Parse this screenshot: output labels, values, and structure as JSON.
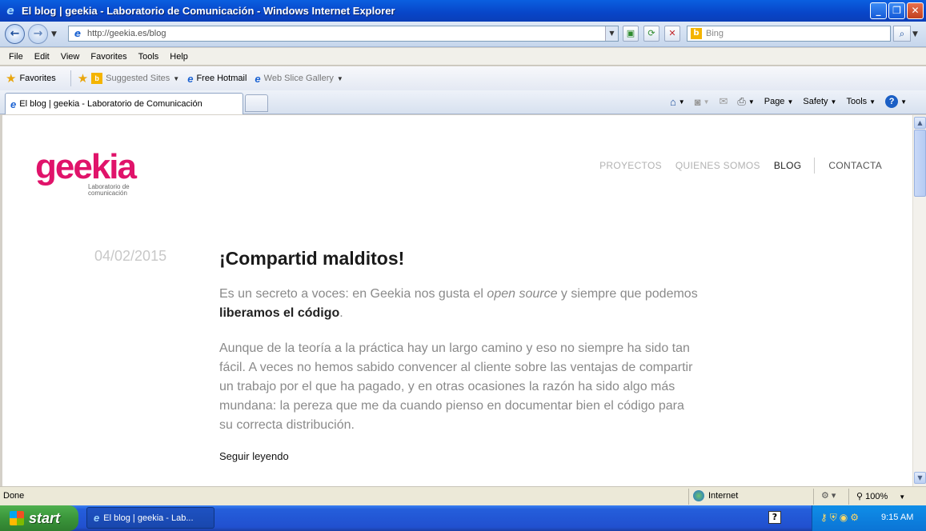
{
  "window": {
    "title": "El blog | geekia - Laboratorio de Comunicación - Windows Internet Explorer",
    "minimize": "_",
    "maximize": "❐",
    "close": "✕"
  },
  "address": {
    "url": "http://geekia.es/blog",
    "search_placeholder": "Bing"
  },
  "menu": [
    "File",
    "Edit",
    "View",
    "Favorites",
    "Tools",
    "Help"
  ],
  "favorites": {
    "label": "Favorites",
    "items": [
      "Suggested Sites",
      "Free Hotmail",
      "Web Slice Gallery"
    ]
  },
  "tab": {
    "title": "El blog | geekia - Laboratorio de Comunicación"
  },
  "commands": {
    "page": "Page",
    "safety": "Safety",
    "tools": "Tools"
  },
  "site": {
    "logo_text": "geekia",
    "logo_sub_1": "Laboratorio de",
    "logo_sub_2": "comunicación",
    "nav": [
      "PROYECTOS",
      "QUIENES SOMOS",
      "BLOG",
      "CONTACTA"
    ],
    "active_nav": "BLOG"
  },
  "post": {
    "date": "04/02/2015",
    "title": "¡Compartid malditos!",
    "p1_a": "Es un secreto a voces: en Geekia nos gusta el ",
    "p1_em": "open source",
    "p1_b": " y siempre que podemos ",
    "p1_strong": "liberamos el código",
    "p1_c": ".",
    "p2": "Aunque de la teoría a la práctica hay un largo camino y eso no siempre ha sido tan fácil. A veces no hemos sabido convencer al cliente sobre las ventajas de compartir un trabajo por el que ha pagado,  y en otras ocasiones la razón ha sido algo más mundana: la pereza que me da cuando pienso en documentar bien el código para su correcta distribución.",
    "read_more": "Seguir leyendo"
  },
  "status": {
    "text": "Done",
    "zone": "Internet",
    "zoom": "100%"
  },
  "taskbar": {
    "start": "start",
    "item": "El blog | geekia - Lab...",
    "clock": "9:15 AM"
  },
  "colors": {
    "brand": "#e0136a",
    "xp_blue": "#0a5fe0",
    "start_green": "#3a953a"
  }
}
